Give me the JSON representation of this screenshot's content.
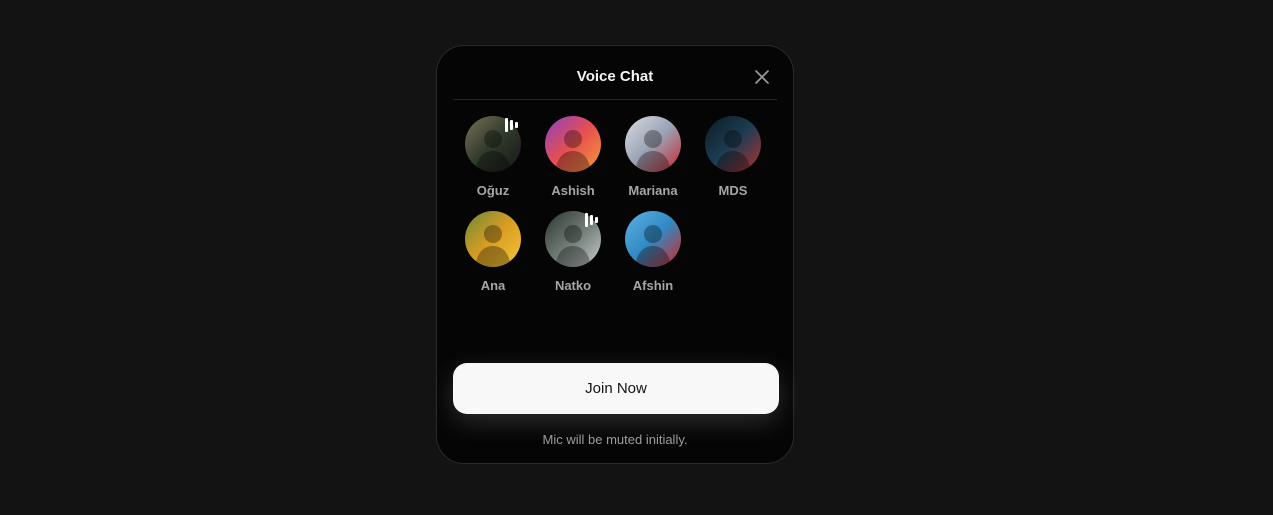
{
  "dialog": {
    "title": "Voice Chat",
    "close_icon": "close-icon",
    "join_label": "Join Now",
    "hint": "Mic will be muted initially."
  },
  "participants": [
    {
      "name": "Oğuz",
      "speaking": true,
      "colors": [
        "#7a7256",
        "#2f3a2c",
        "#171717"
      ]
    },
    {
      "name": "Ashish",
      "speaking": false,
      "colors": [
        "#8c3fc8",
        "#e6504f",
        "#f59a3a"
      ]
    },
    {
      "name": "Mariana",
      "speaking": false,
      "colors": [
        "#d9dce2",
        "#9aa3b5",
        "#c8262e"
      ]
    },
    {
      "name": "MDS",
      "speaking": false,
      "colors": [
        "#0b1b24",
        "#1d3d52",
        "#b23030"
      ]
    },
    {
      "name": "Ana",
      "speaking": false,
      "colors": [
        "#6b8a3a",
        "#d99c22",
        "#f3c83a"
      ]
    },
    {
      "name": "Natko",
      "speaking": true,
      "colors": [
        "#2b3631",
        "#6e7a72",
        "#c9ccd0"
      ]
    },
    {
      "name": "Afshin",
      "speaking": false,
      "colors": [
        "#5fb2e2",
        "#2f89c4",
        "#d42620"
      ]
    }
  ]
}
